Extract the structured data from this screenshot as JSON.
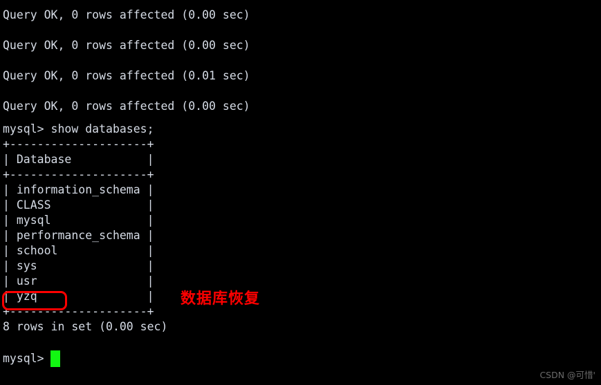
{
  "terminal": {
    "background_color": "#000000",
    "text_color": "#d6dce6",
    "cursor_color": "#12f712",
    "query_results": [
      "Query OK, 0 rows affected (0.00 sec)",
      "Query OK, 0 rows affected (0.00 sec)",
      "Query OK, 0 rows affected (0.01 sec)",
      "Query OK, 0 rows affected (0.00 sec)"
    ],
    "command_line": "mysql> show databases;",
    "table": {
      "border_top": "+--------------------+",
      "header_row": "| Database           |",
      "border_mid": "+--------------------+",
      "rows": [
        "| information_schema |",
        "| CLASS              |",
        "| mysql              |",
        "| performance_schema |",
        "| school             |",
        "| sys                |",
        "| usr                |",
        "| yzq                |"
      ],
      "border_bottom": "+--------------------+",
      "column_header": "Database",
      "databases": [
        "information_schema",
        "CLASS",
        "mysql",
        "performance_schema",
        "school",
        "sys",
        "usr",
        "yzq"
      ]
    },
    "row_count_line": "8 rows in set (0.00 sec)",
    "prompt": "mysql>"
  },
  "annotations": {
    "highlight_target": "yzq",
    "highlight_color": "#fe0000",
    "note_text": "数据库恢复",
    "note_color": "#fe0000"
  },
  "watermark": {
    "text": "CSDN @可惜'"
  }
}
